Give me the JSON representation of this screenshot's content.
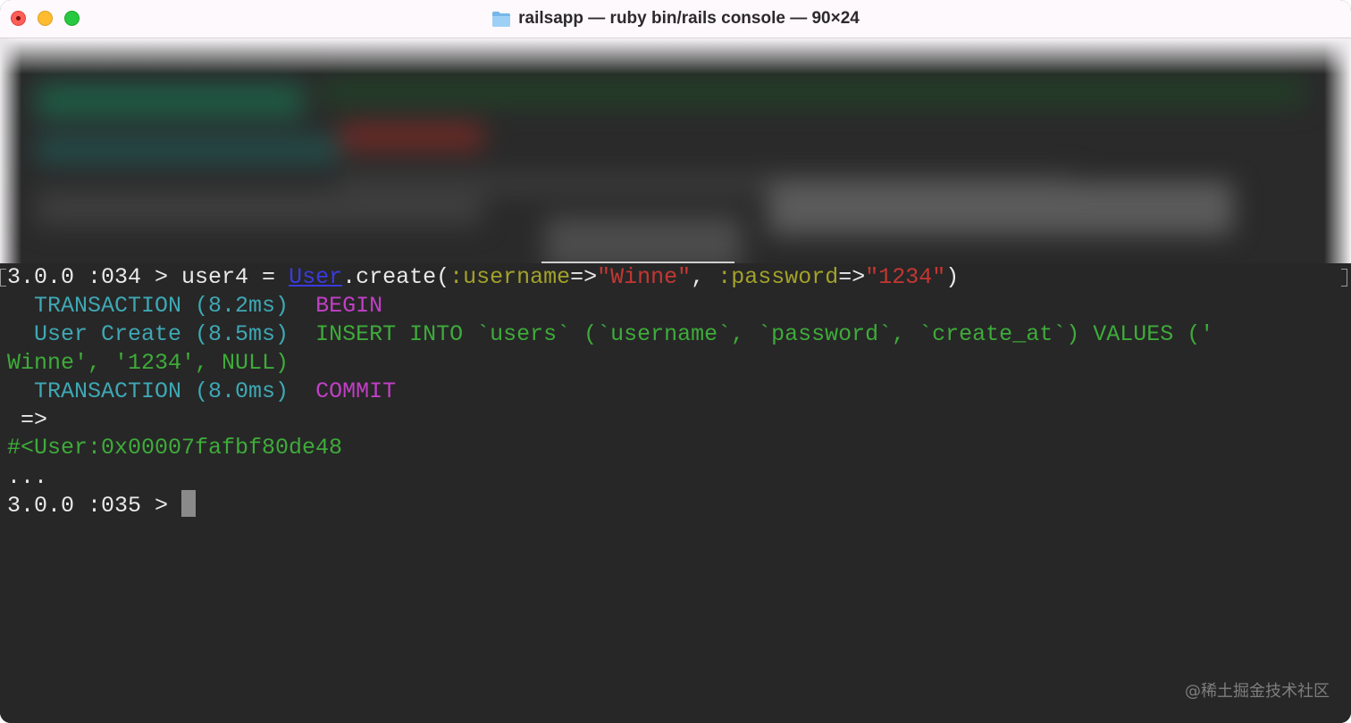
{
  "window": {
    "title": "railsapp — ruby bin/rails console — 90×24",
    "folder_icon": "folder-icon",
    "colors": {
      "close": "#ff5f57",
      "minimize": "#febc2e",
      "maximize": "#28c840",
      "terminal_bg": "#272727"
    }
  },
  "terminal": {
    "line1": {
      "prompt": "3.0.0 :034 > ",
      "code_a": "user4 = ",
      "class_name": "User",
      "code_b": ".create(",
      "sym1": ":username",
      "arrow1": "=>",
      "str1": "\"Winne\"",
      "comma": ", ",
      "sym2": ":password",
      "arrow2": "=>",
      "str2": "\"1234\"",
      "close": ")"
    },
    "line2": {
      "label": "  TRANSACTION (8.2ms)  ",
      "sql": "BEGIN"
    },
    "line3": {
      "label": "  User Create (8.5ms)  ",
      "sql": "INSERT INTO `users` (`username`, `password`, `create_at`) VALUES ('"
    },
    "line4": {
      "sql": "Winne', '1234', NULL)"
    },
    "line5": {
      "label": "  TRANSACTION (8.0ms)  ",
      "sql": "COMMIT"
    },
    "line6": {
      "text": " =>"
    },
    "line7": {
      "text": "#<User:0x00007fafbf80de48"
    },
    "line8": {
      "text": "..."
    },
    "line9": {
      "prompt": "3.0.0 :035 > "
    }
  },
  "watermark": "@稀土掘金技术社区"
}
